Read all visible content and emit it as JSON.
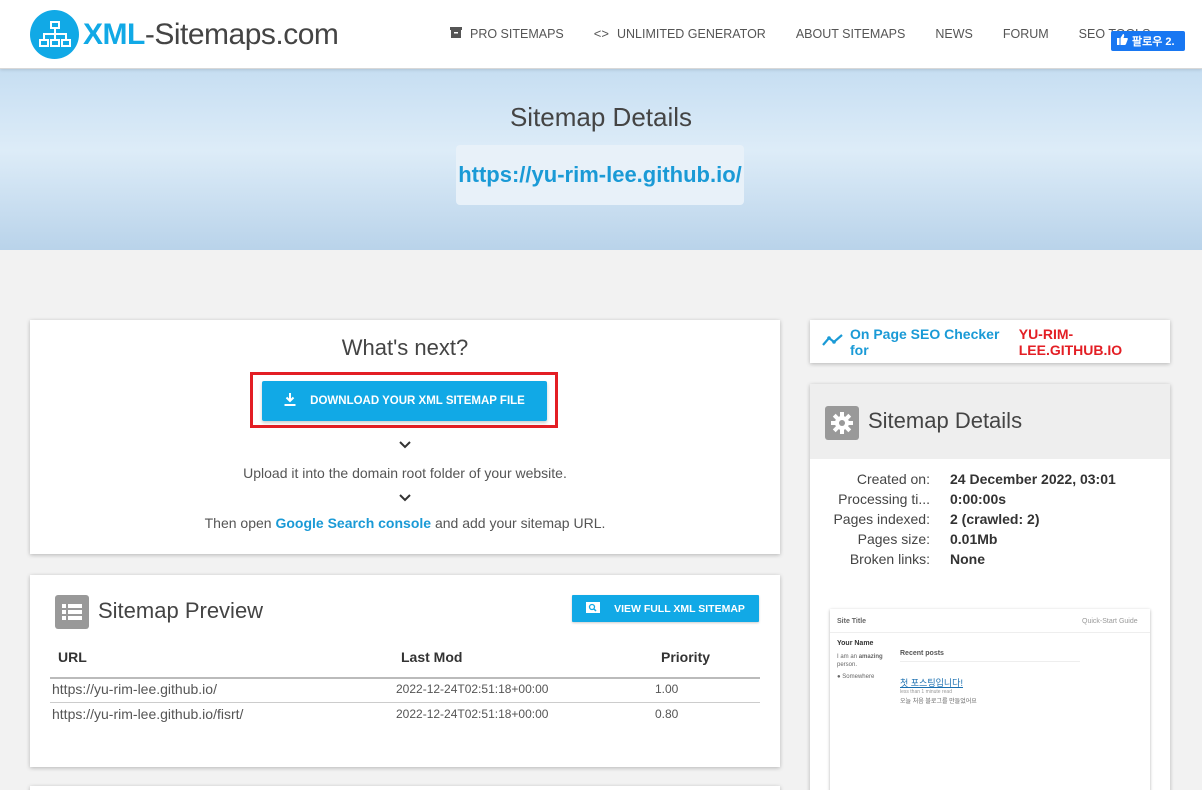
{
  "header": {
    "logo_part1": "XML",
    "logo_part2": "-Sitemaps.com",
    "nav": [
      {
        "label": "PRO SITEMAPS",
        "icon": "archive-icon"
      },
      {
        "label": "UNLIMITED GENERATOR",
        "icon": "code-icon"
      },
      {
        "label": "ABOUT SITEMAPS",
        "icon": ""
      },
      {
        "label": "NEWS",
        "icon": ""
      },
      {
        "label": "FORUM",
        "icon": ""
      },
      {
        "label": "SEO TOOLS",
        "icon": ""
      }
    ],
    "facebook_follow": "팔로우 2.",
    "accent_color": "#11a9e6"
  },
  "hero": {
    "title": "Sitemap Details",
    "url": "https://yu-rim-lee.github.io/"
  },
  "whats_next": {
    "title": "What's next?",
    "download_label": "DOWNLOAD YOUR XML SITEMAP FILE",
    "step1": "Upload it into the domain root folder of your website.",
    "step2_prefix": "Then open",
    "step2_link": "Google Search console",
    "step2_suffix": "and add your sitemap URL."
  },
  "preview": {
    "title": "Sitemap Preview",
    "view_full_label": "VIEW FULL XML SITEMAP",
    "columns": [
      "URL",
      "Last Mod",
      "Priority"
    ],
    "rows": [
      {
        "url": "https://yu-rim-lee.github.io/",
        "lastmod": "2022-12-24T02:51:18+00:00",
        "priority": "1.00"
      },
      {
        "url": "https://yu-rim-lee.github.io/fisrt/",
        "lastmod": "2022-12-24T02:51:18+00:00",
        "priority": "0.80"
      }
    ]
  },
  "seo_checker": {
    "prefix": "On Page SEO Checker for",
    "domain": "YU-RIM-LEE.GITHUB.IO"
  },
  "details": {
    "title": "Sitemap Details",
    "fields": [
      {
        "label": "Created on:",
        "value": "24 December 2022, 03:01"
      },
      {
        "label": "Processing ti...",
        "value": "0:00:00s"
      },
      {
        "label": "Pages indexed:",
        "value": "2 (crawled: 2)"
      },
      {
        "label": "Pages size:",
        "value": "0.01Mb"
      },
      {
        "label": "Broken links:",
        "value": "None"
      }
    ]
  },
  "thumbnail": {
    "site_title": "Site Title",
    "quick_start": "Quick-Start Guide",
    "your_name": "Your Name",
    "bio_prefix": "I am an",
    "bio_bold": "amazing",
    "bio_suffix": "person.",
    "location": "Somewhere",
    "recent_posts": "Recent posts",
    "post_title": "첫 포스팅입니다!",
    "post_meta": "less than 1 minute read",
    "post_excerpt": "오늘 처음 블로그를 만들었어요"
  }
}
